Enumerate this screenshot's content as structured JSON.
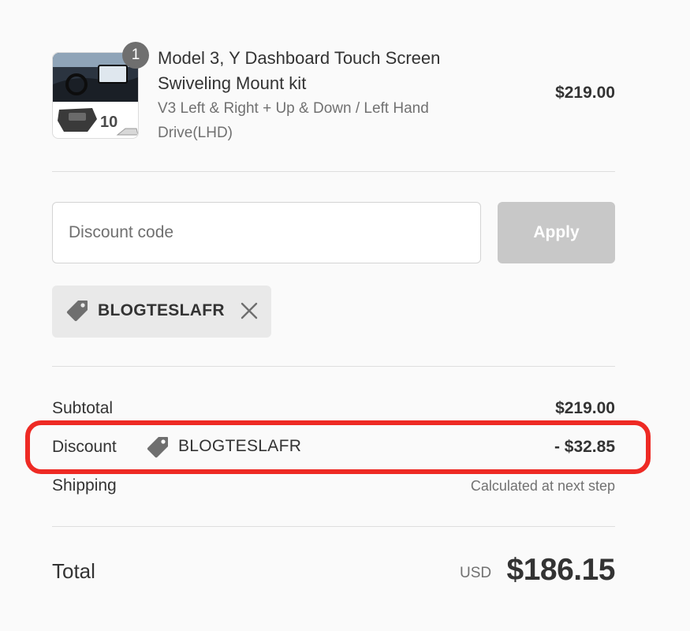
{
  "product": {
    "quantity": "1",
    "title": "Model 3, Y Dashboard Touch Screen Swiveling Mount kit",
    "variant": "V3 Left & Right + Up & Down / Left Hand Drive(LHD)",
    "price": "$219.00",
    "thumbnail_text": "10"
  },
  "discount_form": {
    "placeholder": "Discount code",
    "value": "",
    "apply_label": "Apply"
  },
  "applied_code": {
    "code": "BLOGTESLAFR",
    "icon": "tag-icon",
    "remove_icon": "close-icon"
  },
  "summary": {
    "subtotal_label": "Subtotal",
    "subtotal_value": "$219.00",
    "discount_label": "Discount",
    "discount_code": "BLOGTESLAFR",
    "discount_value": "- $32.85",
    "shipping_label": "Shipping",
    "shipping_value": "Calculated at next step",
    "total_label": "Total",
    "currency": "USD",
    "total_value": "$186.15"
  },
  "colors": {
    "background": "#fafafa",
    "text": "#333333",
    "muted_text": "#717171",
    "apply_button_disabled": "#c8c8c8",
    "chip_background": "#e9e9e9",
    "highlight": "#ee2a24"
  }
}
